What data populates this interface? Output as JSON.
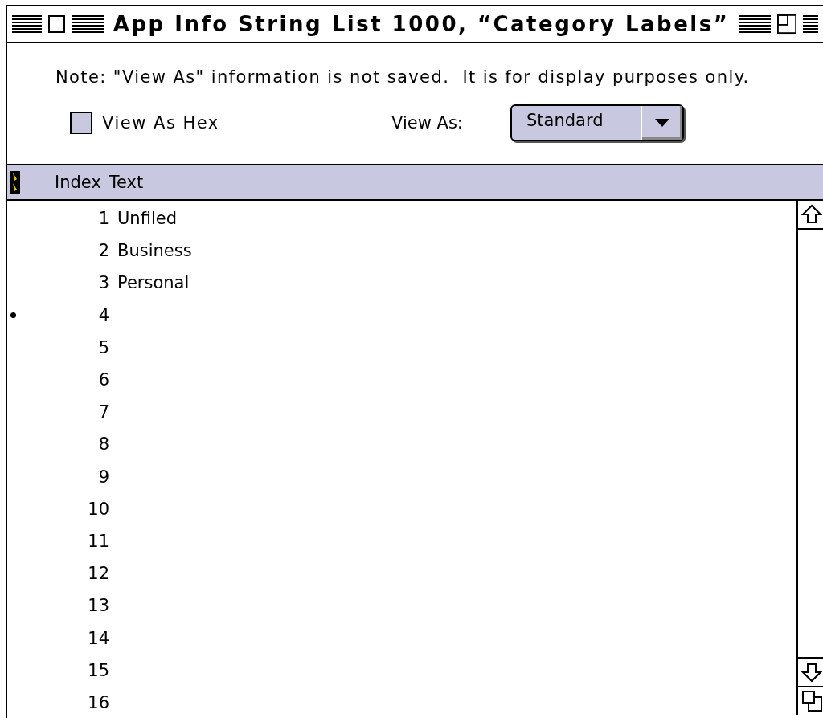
{
  "window": {
    "title": "App Info String List 1000, “Category Labels”"
  },
  "note": "Note: \"View As\" information is not saved.  It is for display purposes only.",
  "view_as_hex": {
    "label": "View As Hex",
    "checked": false
  },
  "view_as": {
    "label": "View As:",
    "value": "Standard"
  },
  "table": {
    "columns": [
      "Index",
      "Text"
    ],
    "rows": [
      {
        "index": "1",
        "text": "Unfiled",
        "marked": false
      },
      {
        "index": "2",
        "text": "Business",
        "marked": false
      },
      {
        "index": "3",
        "text": "Personal",
        "marked": false
      },
      {
        "index": "4",
        "marked": true
      },
      {
        "index": "5",
        "marked": false
      },
      {
        "index": "6",
        "marked": false
      },
      {
        "index": "7",
        "marked": false
      },
      {
        "index": "8",
        "marked": false
      },
      {
        "index": "9",
        "marked": false
      },
      {
        "index": "10",
        "marked": false
      },
      {
        "index": "11",
        "marked": false
      },
      {
        "index": "12",
        "marked": false
      },
      {
        "index": "13",
        "marked": false
      },
      {
        "index": "14",
        "marked": false
      },
      {
        "index": "15",
        "marked": false
      },
      {
        "index": "16",
        "marked": false
      }
    ]
  }
}
